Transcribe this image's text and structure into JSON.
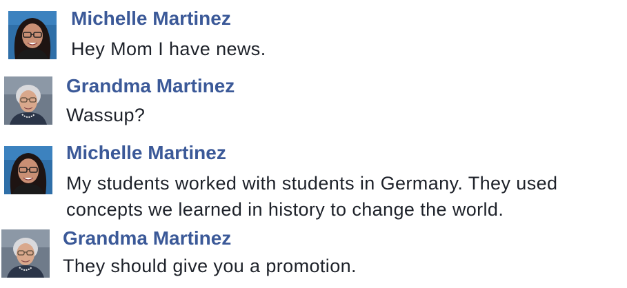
{
  "conversation": {
    "messages": [
      {
        "sender": "Michelle Martinez",
        "avatar": "woman-with-glasses-portrait",
        "lines": [
          "Hey Mom I have news."
        ]
      },
      {
        "sender": "Grandma Martinez",
        "avatar": "grandmother-portrait",
        "lines": [
          "Wassup?"
        ]
      },
      {
        "sender": "Michelle Martinez",
        "avatar": "woman-with-glasses-portrait",
        "lines": [
          "My students worked with students in Germany. They used",
          "concepts we learned in history to change the world."
        ]
      },
      {
        "sender": "Grandma Martinez",
        "avatar": "grandmother-portrait",
        "lines": [
          "They should give you a promotion."
        ]
      }
    ]
  },
  "colors": {
    "sender_name": "#3b5998",
    "message_text": "#1d2129",
    "background": "#ffffff"
  }
}
